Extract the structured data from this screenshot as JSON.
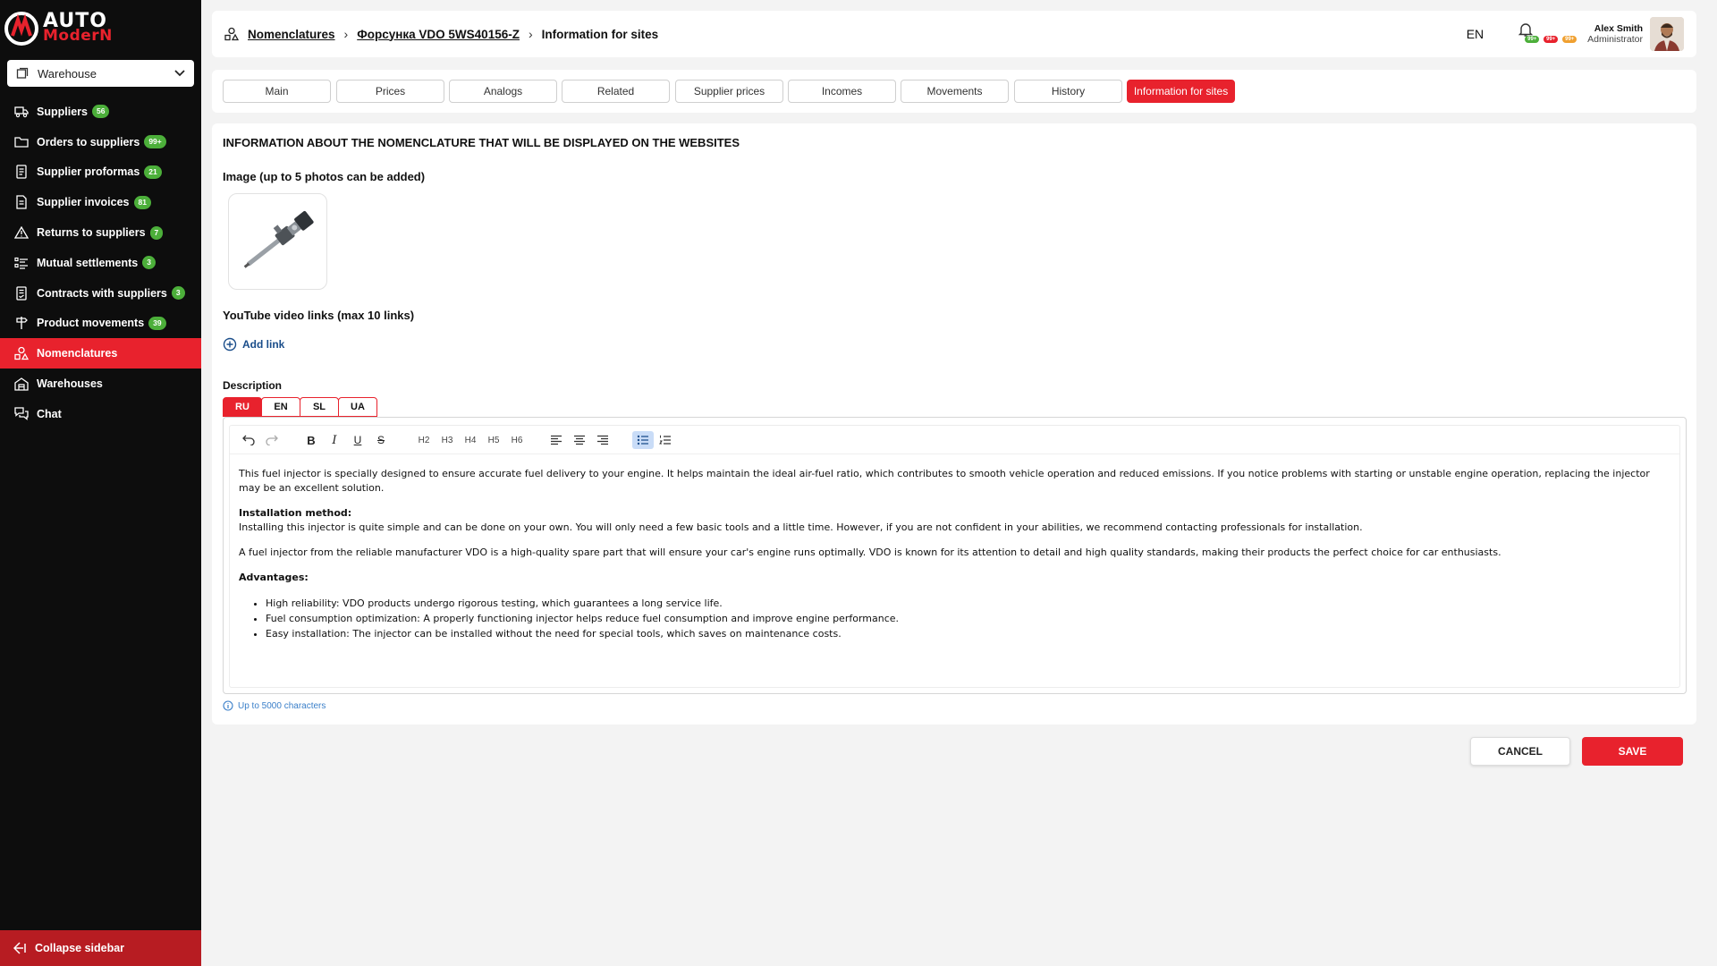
{
  "sidebar": {
    "logo_top": "AUTO",
    "logo_bottom": "ModerN",
    "warehouse_select": "Warehouse",
    "items": [
      {
        "label": "Suppliers",
        "badge": "56",
        "icon": "truck-icon"
      },
      {
        "label": "Orders to suppliers",
        "badge": "99+",
        "icon": "folder-icon"
      },
      {
        "label": "Supplier proformas",
        "badge": "21",
        "icon": "document-icon"
      },
      {
        "label": "Supplier invoices",
        "badge": "81",
        "icon": "invoice-icon"
      },
      {
        "label": "Returns to suppliers",
        "badge": "7",
        "icon": "warning-triangle-icon"
      },
      {
        "label": "Mutual settlements",
        "badge": "3",
        "icon": "list-icon"
      },
      {
        "label": "Contracts with suppliers",
        "badge": "3",
        "icon": "contract-icon"
      },
      {
        "label": "Product movements",
        "badge": "39",
        "icon": "signpost-icon"
      },
      {
        "label": "Nomenclatures",
        "badge": "",
        "icon": "shapes-icon"
      },
      {
        "label": "Warehouses",
        "badge": "",
        "icon": "warehouse-icon"
      },
      {
        "label": "Chat",
        "badge": "",
        "icon": "chat-icon"
      }
    ],
    "active_index": 8,
    "collapse_label": "Collapse sidebar"
  },
  "header": {
    "breadcrumb": [
      "Nomenclatures",
      "Форсунка VDO 5WS40156-Z",
      "Information for sites"
    ],
    "language": "EN",
    "notif_badges": [
      {
        "text": "99+",
        "color": "#4caf3a"
      },
      {
        "text": "99+",
        "color": "#e8222d"
      },
      {
        "text": "99+",
        "color": "#f0a030"
      }
    ],
    "user_name": "Alex Smith",
    "user_role": "Administrator"
  },
  "tabs": [
    "Main",
    "Prices",
    "Analogs",
    "Related",
    "Supplier prices",
    "Incomes",
    "Movements",
    "History",
    "Information for sites"
  ],
  "active_tab": "Information for sites",
  "main": {
    "section_title": "INFORMATION ABOUT THE NOMENCLATURE THAT WILL BE DISPLAYED ON THE WEBSITES",
    "image_label": "Image (up to 5 photos can be added)",
    "youtube_label": "YouTube video links (max 10 links)",
    "add_link": "Add link",
    "description_label": "Description",
    "lang_tabs": [
      "RU",
      "EN",
      "SL",
      "UA"
    ],
    "active_lang": "RU",
    "toolbar": {
      "headings": [
        "H2",
        "H3",
        "H4",
        "H5",
        "H6"
      ]
    },
    "content": {
      "p1": "This fuel injector is specially designed to ensure accurate fuel delivery to your engine. It helps maintain the ideal air-fuel ratio, which contributes to smooth vehicle operation and reduced emissions. If you notice problems with starting or unstable engine operation, replacing the injector may be an excellent solution.",
      "install_heading": "Installation method:",
      "install_text": "Installing this injector is quite simple and can be done on your own. You will only need a few basic tools and a little time. However, if you are not confident in your abilities, we recommend contacting professionals for installation.",
      "p3": "A fuel injector from the reliable manufacturer VDO is a high-quality spare part that will ensure your car's engine runs optimally. VDO is known for its attention to detail and high quality standards, making their products the perfect choice for car enthusiasts.",
      "advantages_heading": "Advantages:",
      "advantages": [
        "High reliability: VDO products undergo rigorous testing, which guarantees a long service life.",
        "Fuel consumption optimization: A properly functioning injector helps reduce fuel consumption and improve engine performance.",
        "Easy installation: The injector can be installed without the need for special tools, which saves on maintenance costs."
      ]
    },
    "char_hint": "Up to 5000 characters"
  },
  "footer": {
    "cancel": "CANCEL",
    "save": "SAVE"
  }
}
